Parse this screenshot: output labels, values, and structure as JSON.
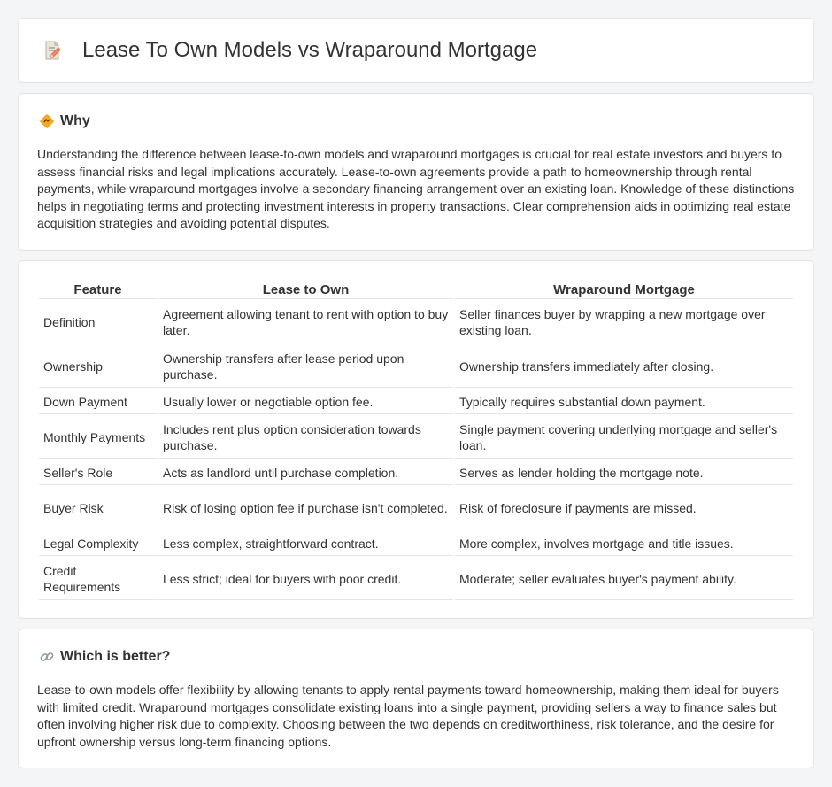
{
  "header": {
    "title": "Lease To Own Models vs Wraparound Mortgage",
    "icon": "document-pencil-icon"
  },
  "why": {
    "heading": "Why",
    "icon": "diamond-sign-icon",
    "text": "Understanding the difference between lease-to-own models and wraparound mortgages is crucial for real estate investors and buyers to assess financial risks and legal implications accurately. Lease-to-own agreements provide a path to homeownership through rental payments, while wraparound mortgages involve a secondary financing arrangement over an existing loan. Knowledge of these distinctions helps in negotiating terms and protecting investment interests in property transactions. Clear comprehension aids in optimizing real estate acquisition strategies and avoiding potential disputes."
  },
  "comparison": {
    "headers": [
      "Feature",
      "Lease to Own",
      "Wraparound Mortgage"
    ],
    "rows": [
      [
        "Definition",
        "Agreement allowing tenant to rent with option to buy later.",
        "Seller finances buyer by wrapping a new mortgage over existing loan."
      ],
      [
        "Ownership",
        "Ownership transfers after lease period upon purchase.",
        "Ownership transfers immediately after closing."
      ],
      [
        "Down Payment",
        "Usually lower or negotiable option fee.",
        "Typically requires substantial down payment."
      ],
      [
        "Monthly Payments",
        "Includes rent plus option consideration towards purchase.",
        "Single payment covering underlying mortgage and seller's loan."
      ],
      [
        "Seller's Role",
        "Acts as landlord until purchase completion.",
        "Serves as lender holding the mortgage note."
      ],
      [
        "Buyer Risk",
        "Risk of losing option fee if purchase isn't completed.",
        "Risk of foreclosure if payments are missed."
      ],
      [
        "Legal Complexity",
        "Less complex, straightforward contract.",
        "More complex, involves mortgage and title issues."
      ],
      [
        "Credit Requirements",
        "Less strict; ideal for buyers with poor credit.",
        "Moderate; seller evaluates buyer's payment ability."
      ]
    ]
  },
  "better": {
    "heading": "Which is better?",
    "icon": "link-icon",
    "text": "Lease-to-own models offer flexibility by allowing tenants to apply rental payments toward homeownership, making them ideal for buyers with limited credit. Wraparound mortgages consolidate existing loans into a single payment, providing sellers a way to finance sales but often involving higher risk due to complexity. Choosing between the two depends on creditworthiness, risk tolerance, and the desire for upfront ownership versus long-term financing options."
  }
}
